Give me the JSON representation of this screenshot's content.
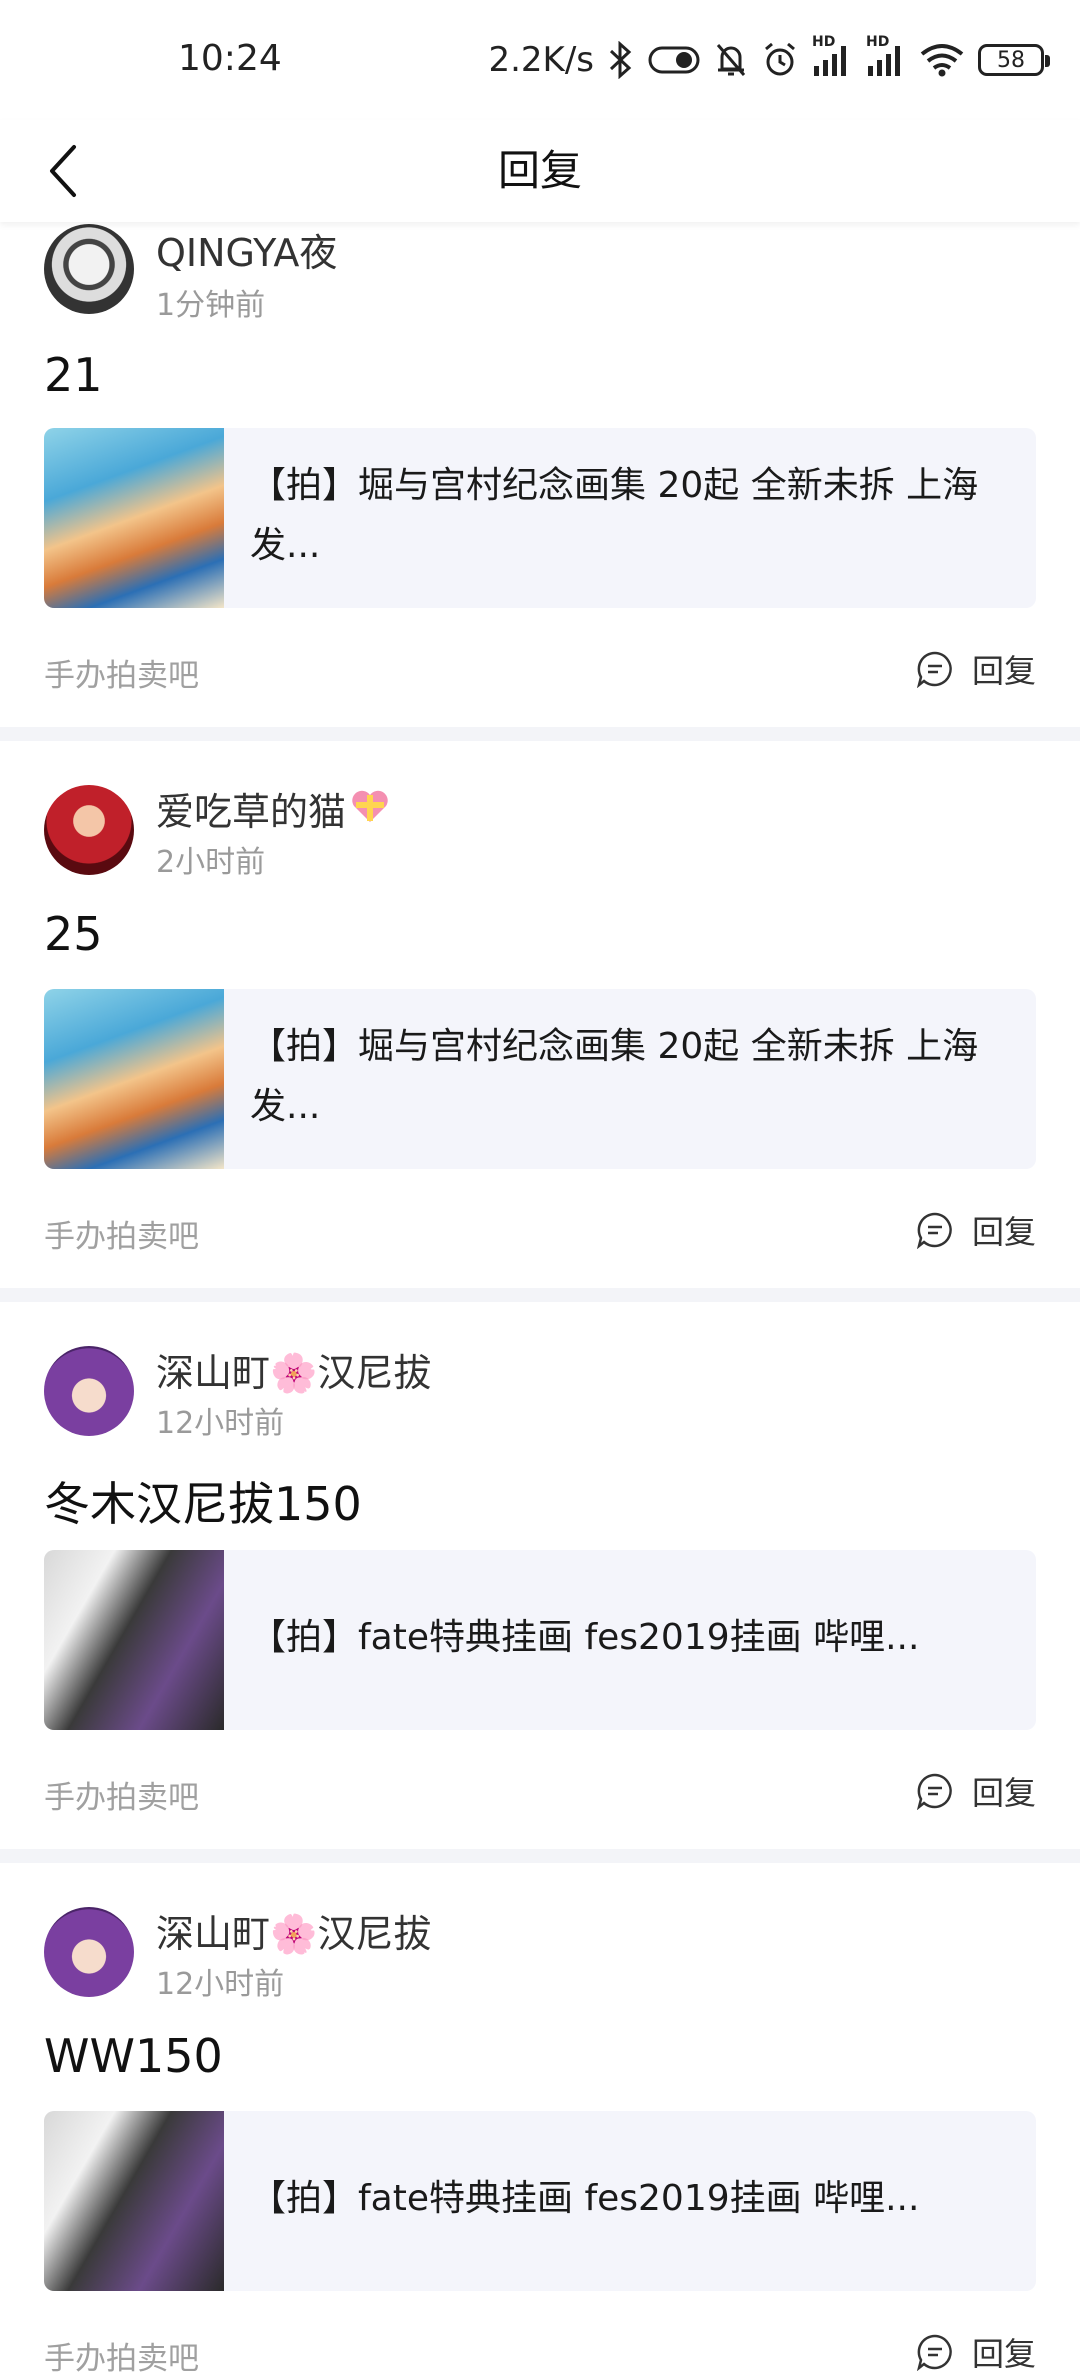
{
  "status_bar": {
    "time": "10:24",
    "net_speed": "2.2K/s",
    "battery": "58",
    "hd1": "HD",
    "hd2": "HD"
  },
  "header": {
    "title": "回复",
    "back_icon": "chevron-left-icon"
  },
  "colors": {
    "separator": "#f3f4f8",
    "post_bg": "#f4f5fb",
    "muted": "#9a9a9a"
  },
  "replies": [
    {
      "user": "QINGYA夜",
      "time": "1分钟前",
      "text": "21",
      "post_title": "【拍】堀与宫村纪念画集 20起 全新未拆 上海发...",
      "forum": "手办拍卖吧",
      "reply_label": "回复"
    },
    {
      "user": "爱吃草的猫",
      "time": "2小时前",
      "text": "25",
      "post_title": "【拍】堀与宫村纪念画集 20起 全新未拆 上海发...",
      "forum": "手办拍卖吧",
      "reply_label": "回复"
    },
    {
      "user": "深山町🌸汉尼拔",
      "time": "12小时前",
      "text": "冬木汉尼拔150",
      "post_title": "【拍】fate特典挂画 fes2019挂画 哔哩...",
      "forum": "手办拍卖吧",
      "reply_label": "回复"
    },
    {
      "user": "深山町🌸汉尼拔",
      "time": "12小时前",
      "text": "WW150",
      "post_title": "【拍】fate特典挂画 fes2019挂画 哔哩...",
      "forum": "手办拍卖吧",
      "reply_label": "回复"
    }
  ]
}
